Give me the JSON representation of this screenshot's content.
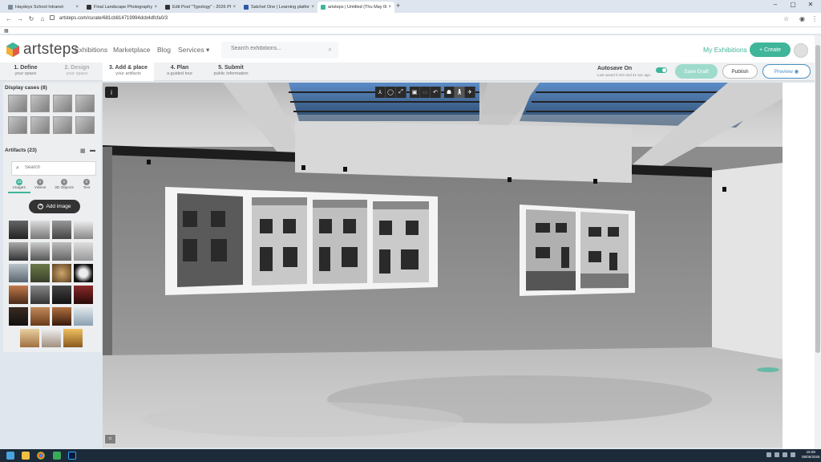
{
  "browser": {
    "tabs": [
      {
        "label": "Haydeys School Intranet",
        "active": false
      },
      {
        "label": "Final Landscape Photography",
        "active": false
      },
      {
        "label": "Edit Post \"Typology\" - 2026 Ph",
        "active": false
      },
      {
        "label": "Satchel One | Learning platform",
        "active": false
      },
      {
        "label": "artsteps | Untitled (Thu May 08",
        "active": true
      }
    ],
    "url": "artsteps.com/curate/681cb814719994dcb4dfcfa0/3"
  },
  "header": {
    "logo_text": "artsteps",
    "nav": [
      "Exhibitions",
      "Marketplace",
      "Blog",
      "Services"
    ],
    "search_placeholder": "Search exhibitions...",
    "my_exhibitions": "My Exhibitions",
    "create_label": "Create"
  },
  "steps": [
    {
      "num": "1. Define",
      "sub": "your space",
      "state": "normal"
    },
    {
      "num": "2. Design",
      "sub": "your space",
      "state": "dim"
    },
    {
      "num": "3. Add & place",
      "sub": "your artifacts",
      "state": "active"
    },
    {
      "num": "4. Plan",
      "sub": "a guided tour",
      "state": "normal"
    },
    {
      "num": "5. Submit",
      "sub": "public information",
      "state": "normal"
    }
  ],
  "autosave": {
    "title": "Autosave On",
    "subtitle": "Last saved 0 min and 41 sec ago",
    "enabled": true
  },
  "actions": {
    "save_draft": "Save Draft",
    "publish": "Publish",
    "preview": "Preview"
  },
  "panel": {
    "display_cases_title": "Display cases (8)",
    "artifacts_title": "Artifacts (23)",
    "search_placeholder": "Search",
    "artifact_tabs": [
      {
        "count": "23",
        "label": "Images",
        "active": true
      },
      {
        "count": "0",
        "label": "Videos",
        "active": false
      },
      {
        "count": "0",
        "label": "3D Objects",
        "active": false
      },
      {
        "count": "0",
        "label": "Text",
        "active": false
      }
    ],
    "add_image_label": "Add image"
  },
  "viewport": {
    "info_icon": "i"
  },
  "taskbar": {
    "time": "15:08",
    "date": "08/05/2025"
  }
}
